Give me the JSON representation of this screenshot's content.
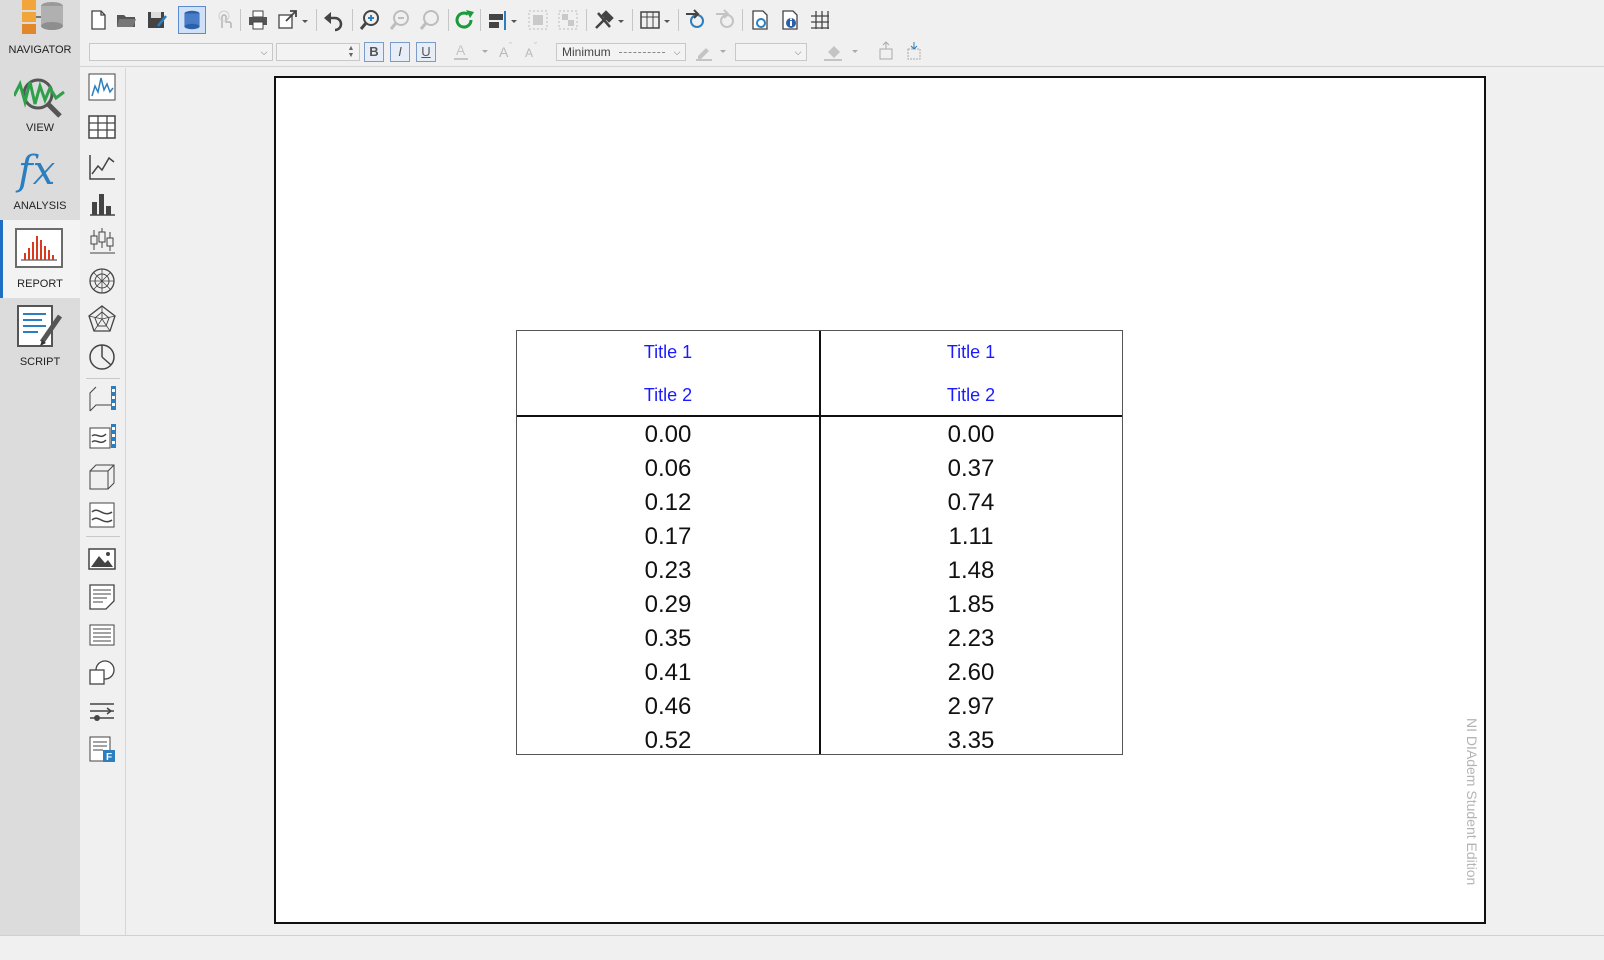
{
  "nav": {
    "items": [
      {
        "label": "NAVIGATOR",
        "icon": "navigator-icon"
      },
      {
        "label": "VIEW",
        "icon": "view-icon"
      },
      {
        "label": "ANALYSIS",
        "icon": "analysis-fx-icon"
      },
      {
        "label": "REPORT",
        "icon": "report-icon",
        "active": true
      },
      {
        "label": "SCRIPT",
        "icon": "script-icon"
      }
    ]
  },
  "toolbar2": {
    "line_width_label": "Minimum"
  },
  "report": {
    "watermark": "NI DIAdem Student Edition",
    "table": {
      "columns": [
        {
          "title1": "Title 1",
          "title2": "Title 2",
          "values": [
            "0.00",
            "0.06",
            "0.12",
            "0.17",
            "0.23",
            "0.29",
            "0.35",
            "0.41",
            "0.46",
            "0.52"
          ]
        },
        {
          "title1": "Title 1",
          "title2": "Title 2",
          "values": [
            "0.00",
            "0.37",
            "0.74",
            "1.11",
            "1.48",
            "1.85",
            "2.23",
            "2.60",
            "2.97",
            "3.35"
          ]
        }
      ]
    }
  },
  "colors": {
    "header_text": "#1a1aff",
    "accent": "#1f6fc5",
    "chart_red": "#d93a1f"
  }
}
